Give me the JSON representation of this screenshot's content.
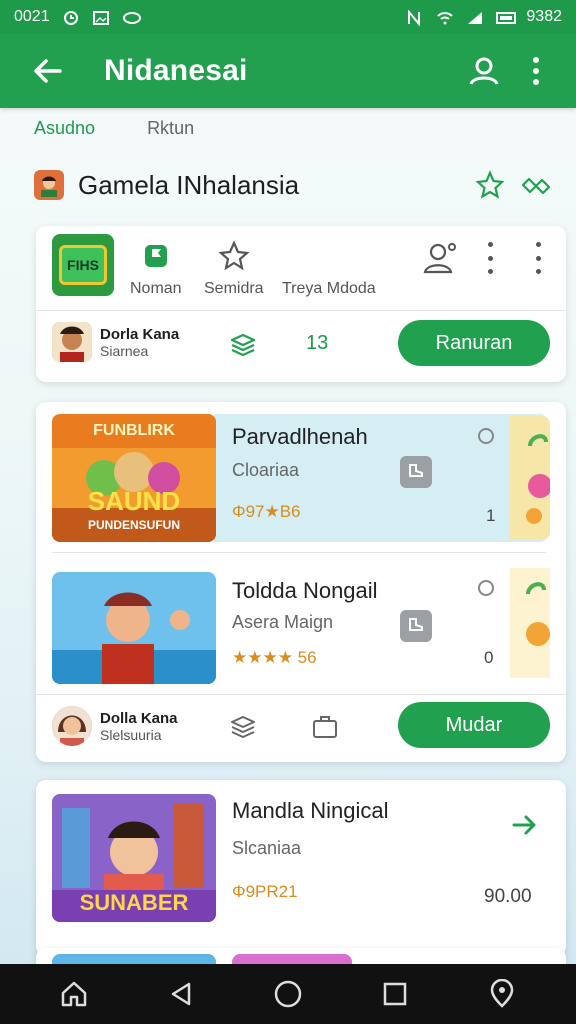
{
  "status_bar": {
    "time": "0021",
    "battery_text": "9382"
  },
  "app_bar": {
    "title": "Nidanesai",
    "icons": [
      "back-arrow-icon",
      "user-icon",
      "more-vert-icon"
    ]
  },
  "tabs": [
    {
      "label": "Asudno",
      "active": true
    },
    {
      "label": "Rktun",
      "active": false
    }
  ],
  "section": {
    "heading": "Gamela INhalansia",
    "icons": [
      "star-outline-icon",
      "handshake-icon"
    ]
  },
  "top_card": {
    "logo_text": "FIHS",
    "quick_actions": [
      {
        "label": "Noman",
        "icon": "flag-icon"
      },
      {
        "label": "Semidra",
        "icon": "star-icon"
      },
      {
        "label": "Treya Mdoda",
        "icon": ""
      }
    ],
    "user": {
      "name": "Dorla Kana",
      "sub": "Siarnea"
    },
    "count": "13",
    "action_label": "Ranuran"
  },
  "game_card": {
    "items": [
      {
        "thumb_title": "FUNBLIRK",
        "thumb_main": "SAUND",
        "thumb_sub": "PUNDENSUFUN",
        "title": "Parvadlhenah",
        "sub": "Cloariaa",
        "rating": "Φ97★B6",
        "side_num": "1"
      },
      {
        "title": "Toldda Nongail",
        "sub": "Asera Maign",
        "rating": "★★★★ 56",
        "side_num": "0"
      }
    ],
    "user": {
      "name": "Dolla Kana",
      "sub": "Slelsuuria"
    },
    "action_label": "Mudar"
  },
  "featured": {
    "thumb_text": "SUNABER",
    "title": "Mandla Ningical",
    "sub": "Slcaniaa",
    "rating": "Φ9PR21",
    "price": "90.00"
  },
  "colors": {
    "primary": "#22a04f",
    "primary_dark": "#1f9a4b",
    "rating": "#d98c1f"
  }
}
